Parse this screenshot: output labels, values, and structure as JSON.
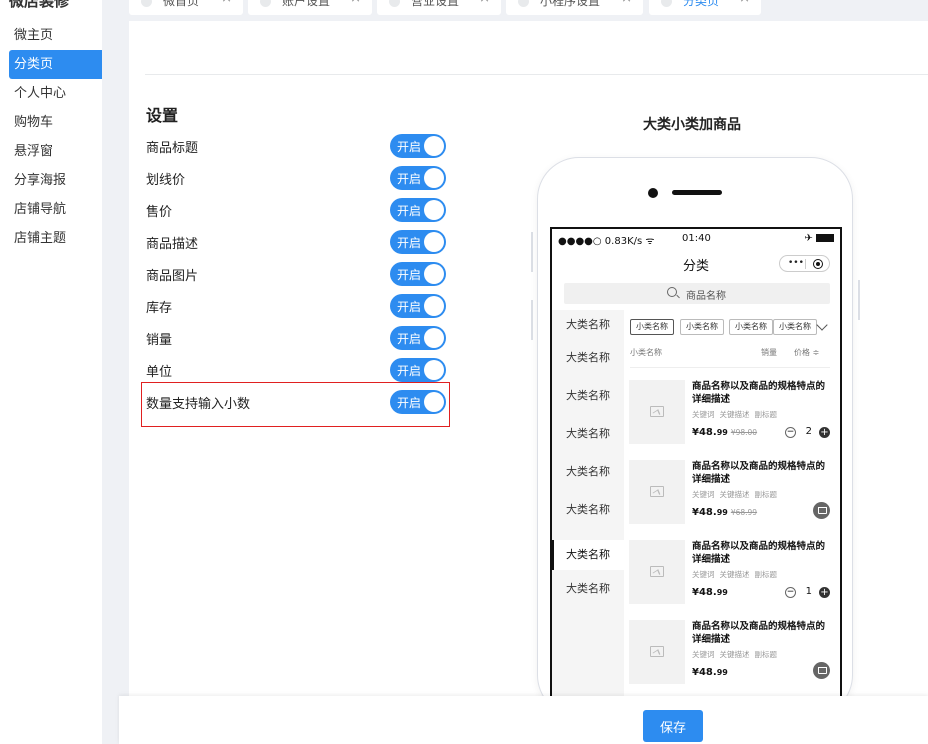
{
  "sidebar": {
    "title": "微店装修",
    "items": [
      {
        "label": "微主页"
      },
      {
        "label": "分类页"
      },
      {
        "label": "个人中心"
      },
      {
        "label": "购物车"
      },
      {
        "label": "悬浮窗"
      },
      {
        "label": "分享海报"
      },
      {
        "label": "店铺导航"
      },
      {
        "label": "店铺主题"
      }
    ],
    "active_index": 1
  },
  "tabs": [
    {
      "label": "微首页"
    },
    {
      "label": "账户设置"
    },
    {
      "label": "营业设置"
    },
    {
      "label": "小程序设置"
    },
    {
      "label": "分类页"
    }
  ],
  "tab_close_glyph": "×",
  "settings": {
    "title": "设置",
    "toggle_on_label": "开启",
    "items": [
      {
        "label": "商品标题",
        "enabled": true
      },
      {
        "label": "划线价",
        "enabled": true
      },
      {
        "label": "售价",
        "enabled": true
      },
      {
        "label": "商品描述",
        "enabled": true
      },
      {
        "label": "商品图片",
        "enabled": true
      },
      {
        "label": "库存",
        "enabled": true
      },
      {
        "label": "销量",
        "enabled": true
      },
      {
        "label": "单位",
        "enabled": true
      },
      {
        "label": "数量支持输入小数",
        "enabled": true
      }
    ]
  },
  "preview": {
    "title": "大类小类加商品",
    "status": {
      "left": "●●●●○ 0.83K/s",
      "time": "01:40"
    },
    "nav_title": "分类",
    "capsule_dots": "•••",
    "search_placeholder": "商品名称",
    "categories": [
      "大类名称",
      "大类名称",
      "大类名称",
      "大类名称",
      "大类名称",
      "大类名称",
      "大类名称",
      "大类名称"
    ],
    "active_category_index": 6,
    "subcategories": [
      "小类名称",
      "小类名称",
      "小类名称",
      "小类名称"
    ],
    "sort_bar": {
      "name": "小类名称",
      "sales": "销量",
      "price": "价格 ≑"
    },
    "products": [
      {
        "name": "商品名称以及商品的规格特点的详细描述",
        "tags": [
          "关键词",
          "关键描述",
          "副标题"
        ],
        "price_main": "¥48.",
        "price_cents": "99",
        "original_price": "¥98.00",
        "control": "stepper",
        "qty": "2"
      },
      {
        "name": "商品名称以及商品的规格特点的详细描述",
        "tags": [
          "关键词",
          "关键描述",
          "副标题"
        ],
        "price_main": "¥48.",
        "price_cents": "99",
        "original_price": "¥68.99",
        "control": "cart"
      },
      {
        "name": "商品名称以及商品的规格特点的详细描述",
        "tags": [
          "关键词",
          "关键描述",
          "副标题"
        ],
        "price_main": "¥48.",
        "price_cents": "99",
        "original_price": "",
        "control": "stepper",
        "qty": "1"
      },
      {
        "name": "商品名称以及商品的规格特点的详细描述",
        "tags": [
          "关键词",
          "关键描述",
          "副标题"
        ],
        "price_main": "¥48.",
        "price_cents": "99",
        "original_price": "",
        "control": "cart"
      }
    ],
    "stepper_minus": "−",
    "stepper_plus": "+"
  },
  "footer": {
    "save_label": "保存"
  },
  "colors": {
    "accent": "#2d8cf0",
    "highlight_border": "#e02020",
    "background": "#eff1f5"
  }
}
